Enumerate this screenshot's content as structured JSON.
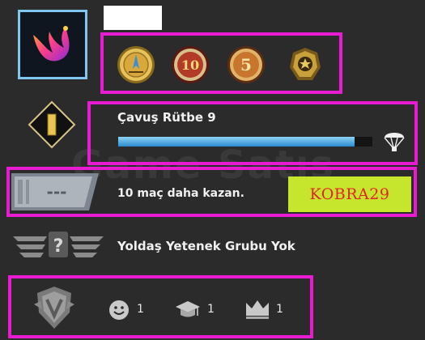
{
  "profile": {
    "avatar_icon": "pink-phoenix-icon",
    "name_redacted": true
  },
  "medals": [
    {
      "name": "gold-coin-medal-icon",
      "color": "#d4a93a"
    },
    {
      "name": "ten-year-coin-medal-icon",
      "label": "10",
      "color": "#b83a2a"
    },
    {
      "name": "five-year-coin-medal-icon",
      "label": "5",
      "color": "#c87a30"
    },
    {
      "name": "operation-badge-medal-icon",
      "color": "#c9a13a"
    }
  ],
  "rank": {
    "label": "Çavuş Rütbe 9",
    "progress": 0.93,
    "icon": "rank-diamond-icon",
    "reward_icon": "parachute-drop-icon"
  },
  "wins": {
    "text": "10 maç daha kazan.",
    "banner_text": "---",
    "promo_code": "KOBRA29",
    "promo_bg": "#c6e62d",
    "promo_color": "#e32222"
  },
  "skill_group": {
    "text": "Yoldaş Yetenek Grubu Yok",
    "icon": "unknown-skill-wings-icon"
  },
  "commendations": [
    {
      "name": "friendly",
      "icon": "smiley-icon",
      "count": "1"
    },
    {
      "name": "teacher",
      "icon": "graduation-cap-icon",
      "count": "1"
    },
    {
      "name": "leader",
      "icon": "crown-icon",
      "count": "1"
    }
  ],
  "watermark": "Game Satış",
  "highlight_color": "#e81bd2"
}
